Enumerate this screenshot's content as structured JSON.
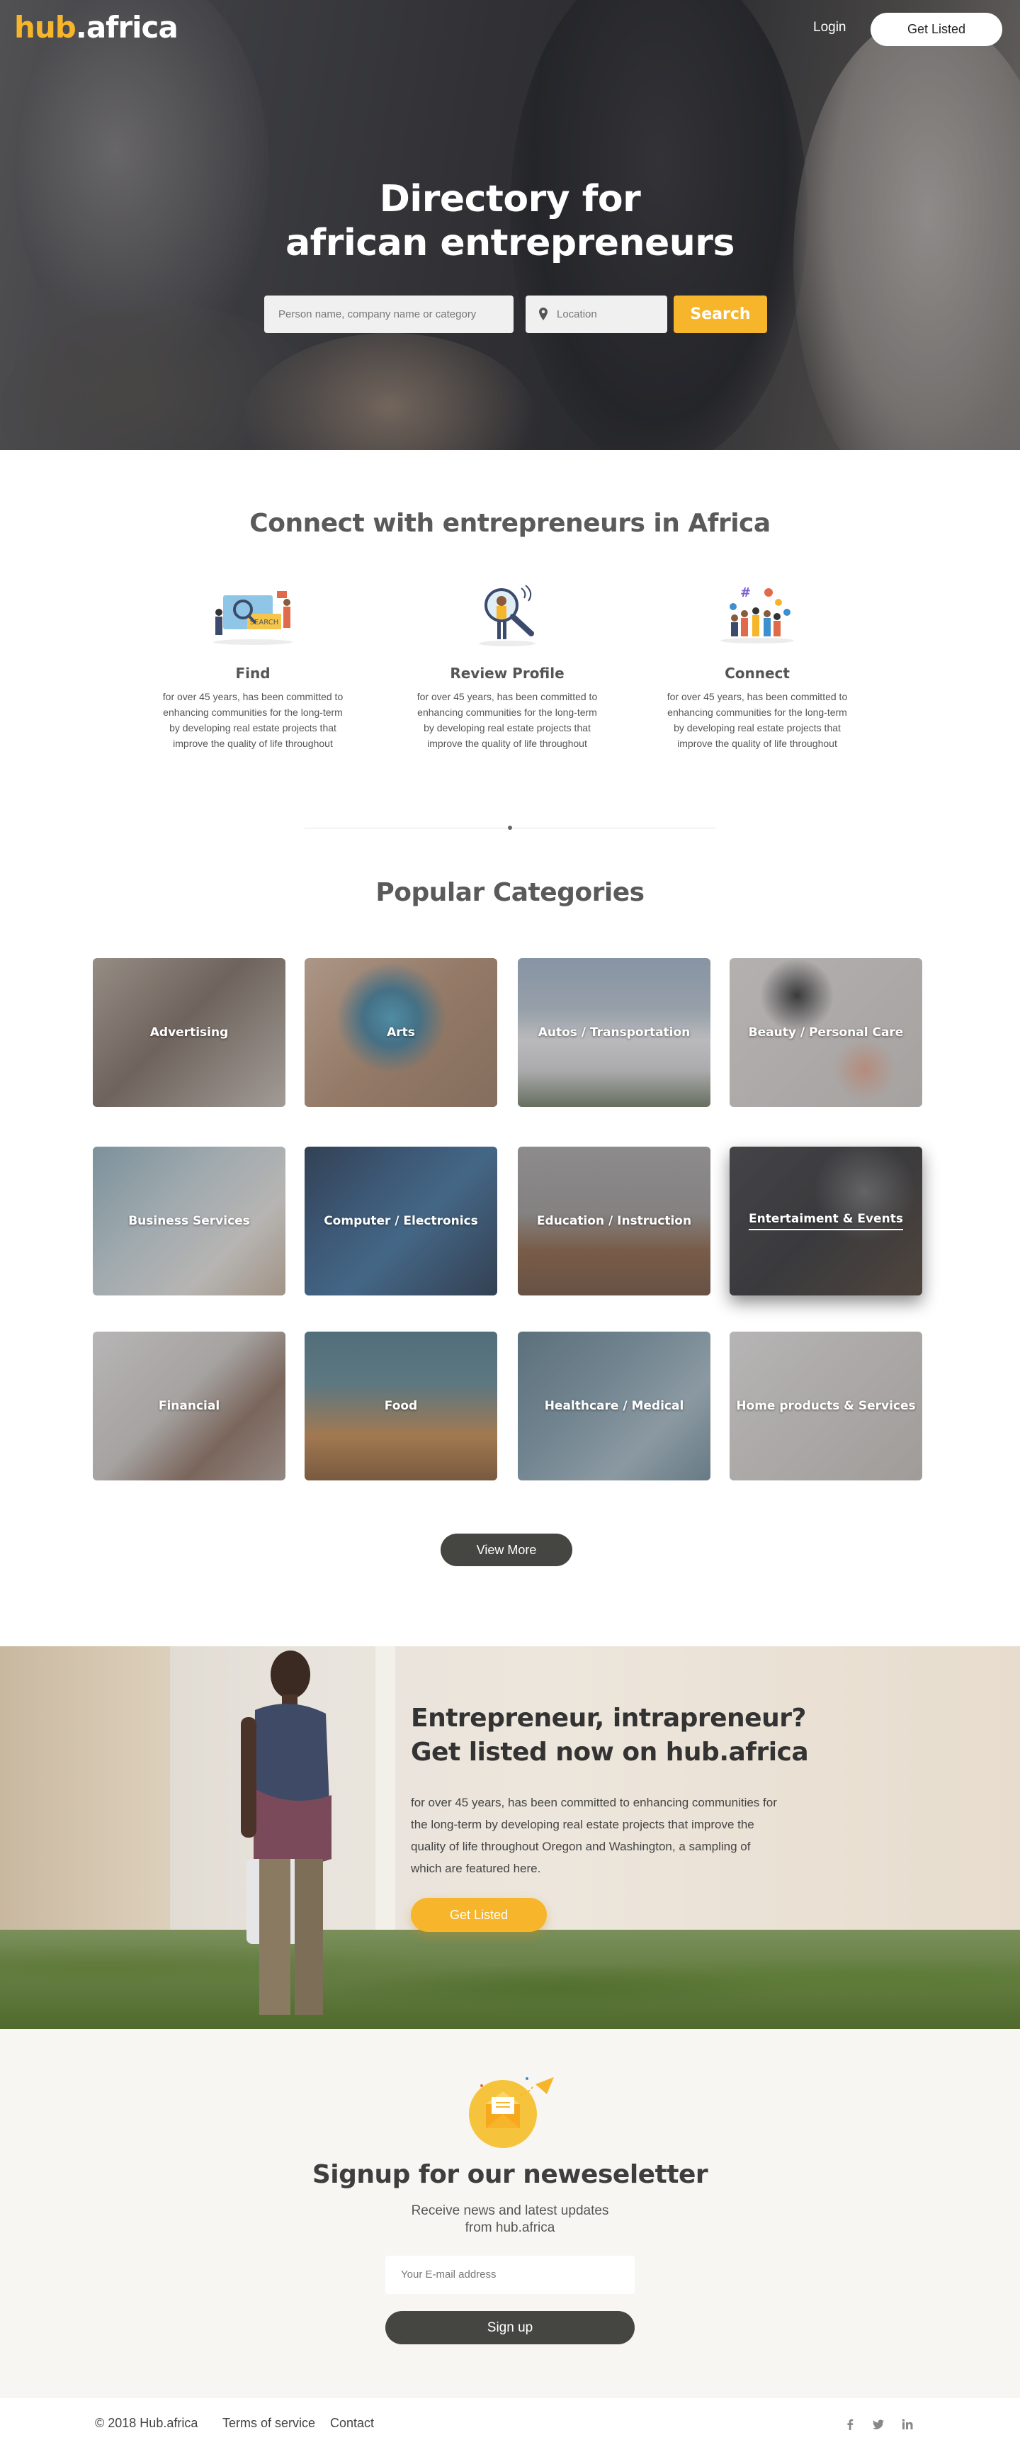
{
  "header": {
    "logo_part1": "hub",
    "logo_part2": ".africa",
    "login_label": "Login",
    "get_listed_label": "Get Listed"
  },
  "hero": {
    "title_line1": "Directory for",
    "title_line2": "african entrepreneurs",
    "search_placeholder": "Person name, company name or category",
    "location_placeholder": "Location",
    "search_button": "Search"
  },
  "connect": {
    "title": "Connect with entrepreneurs in Africa",
    "features": [
      {
        "title": "Find",
        "text": "for over 45 years, has been committed to enhancing communities for the long-term by developing real estate projects that improve the quality of life throughout",
        "icon": "search-people-illustration"
      },
      {
        "title": "Review Profile",
        "text": "for over 45 years, has been committed to enhancing communities for the long-term by developing real estate projects that improve the quality of life throughout",
        "icon": "magnifier-person-illustration"
      },
      {
        "title": "Connect",
        "text": "for over 45 years, has been committed to enhancing communities for the long-term by developing real estate projects that improve the quality of life throughout",
        "icon": "group-people-illustration"
      }
    ]
  },
  "categories": {
    "title": "Popular Categories",
    "items": [
      {
        "label": "Advertising"
      },
      {
        "label": "Arts"
      },
      {
        "label": "Autos / Transportation"
      },
      {
        "label": "Beauty / Personal Care"
      },
      {
        "label": "Business Services"
      },
      {
        "label": "Computer / Electronics"
      },
      {
        "label": "Education / Instruction"
      },
      {
        "label": "Entertaiment & Events"
      },
      {
        "label": "Financial"
      },
      {
        "label": "Food"
      },
      {
        "label": "Healthcare / Medical"
      },
      {
        "label": "Home products & Services"
      }
    ],
    "view_more": "View More"
  },
  "promo": {
    "title_line1": "Entrepreneur, intrapreneur?",
    "title_line2": "Get listed now on  hub.africa",
    "text": "for over 45 years, has been committed to enhancing communities for the long-term by developing real estate projects that improve the quality of life throughout Oregon and Washington, a sampling of which are featured here.",
    "button": "Get Listed"
  },
  "newsletter": {
    "title": "Signup for our neweseletter",
    "subtitle_line1": "Receive news and latest updates",
    "subtitle_line2": "from hub.africa",
    "email_placeholder": "Your E-mail address",
    "button": "Sign up"
  },
  "footer": {
    "copyright": "© 2018 Hub.africa",
    "terms": "Terms of service",
    "contact": "Contact",
    "social": [
      "facebook-icon",
      "twitter-icon",
      "linkedin-icon"
    ]
  },
  "colors": {
    "accent": "#f6b52a",
    "dark_button": "#454541",
    "heading": "#5a5a5a"
  }
}
